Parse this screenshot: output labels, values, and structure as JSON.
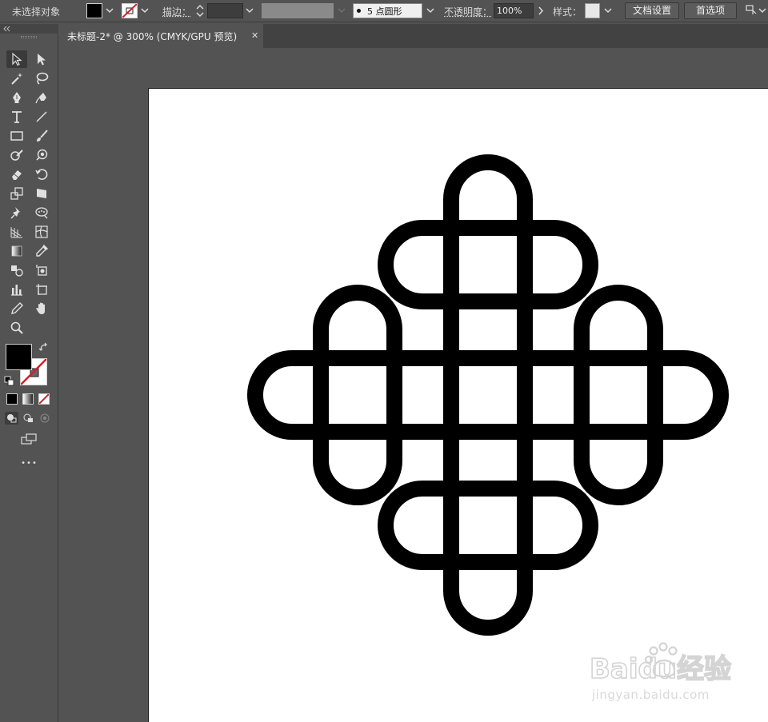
{
  "control_bar": {
    "selection_status": "未选择对象",
    "stroke_label": "描边：",
    "brush_value": "5 点圆形",
    "opacity_label": "不透明度：",
    "opacity_value": "100%",
    "style_label": "样式：",
    "doc_setup_button": "文档设置",
    "preferences_button": "首选项",
    "fill_color": "#000000"
  },
  "document_tab": {
    "title": "未标题-2* @ 300% (CMYK/GPU 预览)",
    "close_glyph": "✕"
  },
  "toolbar": {
    "tools": [
      "selection-tool",
      "direct-selection-tool",
      "magic-wand-tool",
      "lasso-tool",
      "pen-tool",
      "curvature-tool",
      "type-tool",
      "line-tool",
      "rectangle-tool",
      "paintbrush-tool",
      "shaper-tool",
      "shape-builder-tool",
      "eraser-tool",
      "rotate-tool",
      "scale-tool",
      "free-transform-tool",
      "puppet-warp-tool",
      "symbol-sprayer-tool",
      "perspective-grid-tool",
      "mesh-tool",
      "gradient-tool",
      "eyedropper-tool",
      "blend-tool",
      "artboard-tool",
      "graph-tool",
      "slice-tool",
      "pencil-tool",
      "hand-tool",
      "zoom-tool"
    ],
    "more_glyph": "•••"
  },
  "watermark": {
    "brand": "Baidu经验",
    "url": "jingyan.baidu.com"
  },
  "colors": {
    "ui_bg": "#535353",
    "artwork": "#000000",
    "artboard": "#ffffff",
    "none_swatch_slash": "#d0202b"
  }
}
